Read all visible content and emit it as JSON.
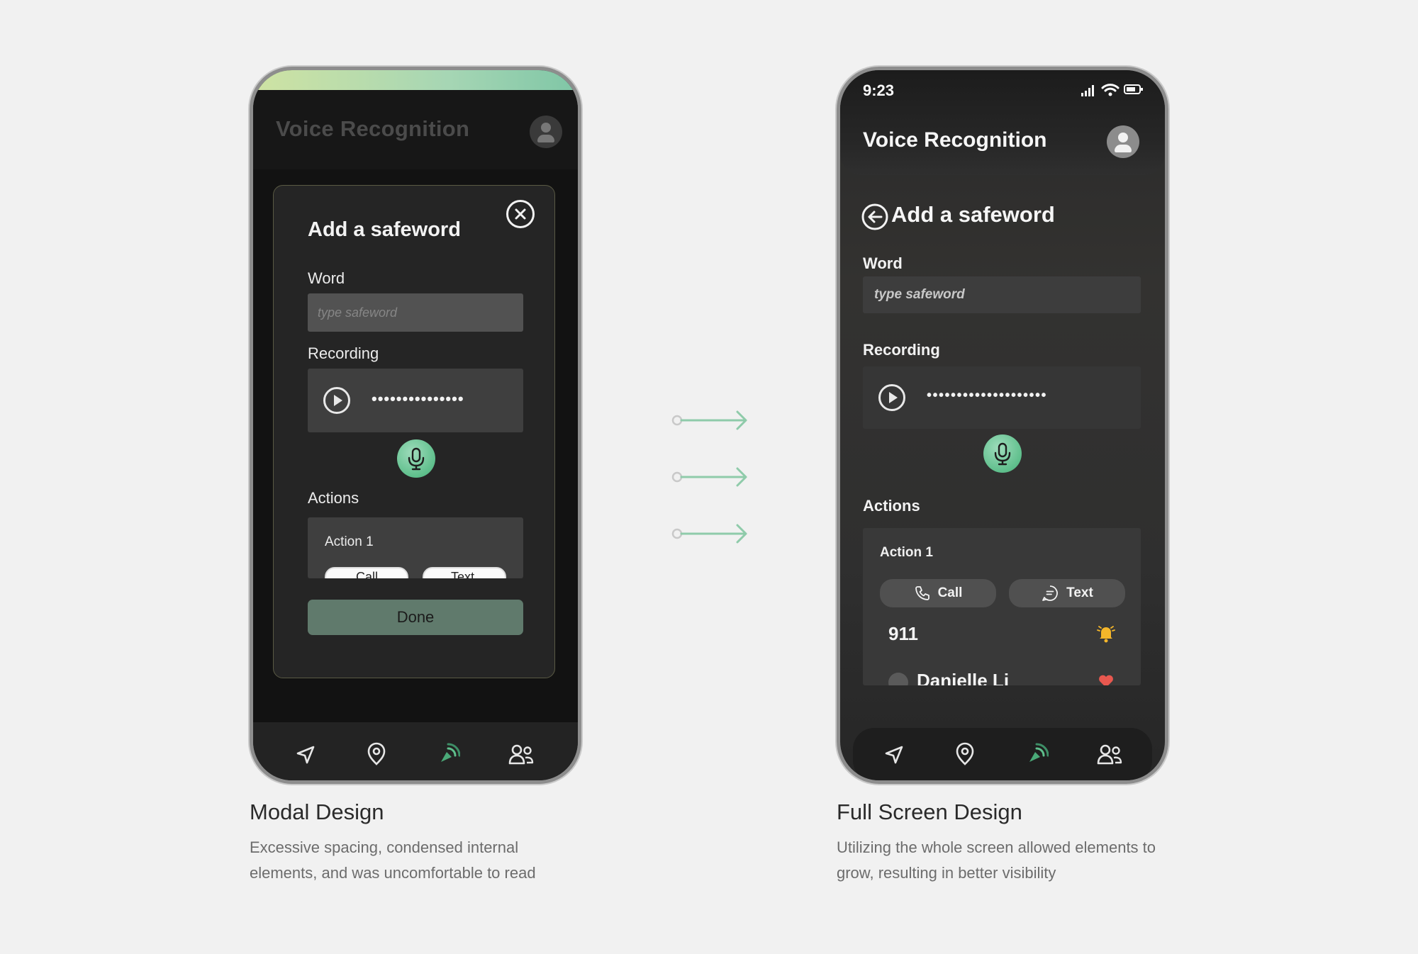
{
  "modal_design": {
    "app_title": "Voice Recognition",
    "dialog_title": "Add a safeword",
    "word_label": "Word",
    "word_placeholder": "type safeword",
    "recording_label": "Recording",
    "recording_dots": "•••••••••••••••",
    "actions_label": "Actions",
    "action_title": "Action 1",
    "call_label": "Call",
    "text_label": "Text",
    "done_label": "Done"
  },
  "full_screen_design": {
    "status_time": "9:23",
    "app_title": "Voice Recognition",
    "page_title": "Add a safeword",
    "word_label": "Word",
    "word_placeholder": "type safeword",
    "recording_label": "Recording",
    "recording_dots": "••••••••••••••••••••",
    "actions_label": "Actions",
    "action_title": "Action 1",
    "call_label": "Call",
    "text_label": "Text",
    "contact_number": "911",
    "contact_name": "Danielle Li"
  },
  "nav": {
    "items": [
      "navigate-icon",
      "location-pin-icon",
      "voice-recognition-icon",
      "contacts-icon"
    ],
    "active_index": 2
  },
  "captions": {
    "left_title": "Modal Design",
    "left_text": "Excessive spacing, condensed internal elements, and  was uncomfortable to read",
    "right_title": "Full Screen Design",
    "right_text": "Utilizing the whole screen allowed elements to grow, resulting in better visibility"
  },
  "colors": {
    "accent_green": "#5fbf8c",
    "arrow_green": "#8fcbaa",
    "page_background": "#f1f1f1",
    "bell_yellow": "#f4b62a",
    "heart_red": "#e8584f"
  }
}
